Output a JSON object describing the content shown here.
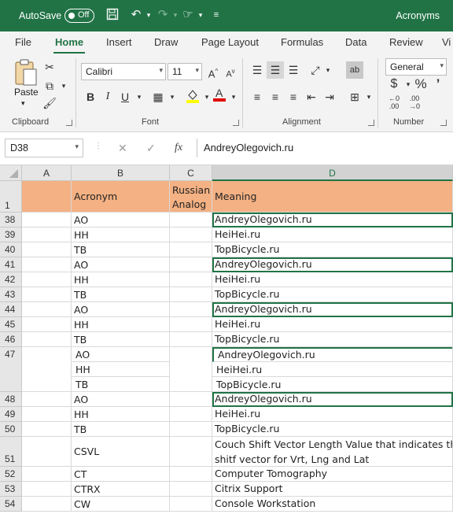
{
  "titlebar": {
    "autosave_label": "AutoSave",
    "autosave_state": "Off",
    "doc_title": "Acronyms"
  },
  "tabs": [
    "File",
    "Home",
    "Insert",
    "Draw",
    "Page Layout",
    "Formulas",
    "Data",
    "Review",
    "Vi"
  ],
  "ribbon": {
    "paste_label": "Paste",
    "font_name": "Calibri",
    "font_size": "11",
    "number_format": "General",
    "groups": {
      "clipboard": "Clipboard",
      "font": "Font",
      "alignment": "Alignment",
      "number": "Number"
    }
  },
  "formula_bar": {
    "name_box": "D38",
    "formula": "AndreyOlegovich.ru"
  },
  "grid": {
    "columns": [
      "A",
      "B",
      "C",
      "D"
    ],
    "header_row": {
      "row_num": "1",
      "b": "Acronym",
      "c_line1": "Russian",
      "c_line2": "Analog",
      "d": "Meaning"
    },
    "rows": [
      {
        "num": "38",
        "b": "AO",
        "d": "AndreyOlegovich.ru"
      },
      {
        "num": "39",
        "b": "HH",
        "d": "HeiHei.ru"
      },
      {
        "num": "40",
        "b": "TB",
        "d": "TopBicycle.ru"
      },
      {
        "num": "41",
        "b": "AO",
        "d": "AndreyOlegovich.ru"
      },
      {
        "num": "42",
        "b": "HH",
        "d": "HeiHei.ru"
      },
      {
        "num": "43",
        "b": "TB",
        "d": "TopBicycle.ru"
      },
      {
        "num": "44",
        "b": "AO",
        "d": "AndreyOlegovich.ru"
      },
      {
        "num": "45",
        "b": "HH",
        "d": "HeiHei.ru"
      },
      {
        "num": "46",
        "b": "TB",
        "d": "TopBicycle.ru"
      },
      {
        "num": "47",
        "b": "AO",
        "d": "AndreyOlegovich.ru",
        "b2": "HH",
        "d2": "HeiHei.ru",
        "b3": "TB",
        "d3": "TopBicycle.ru"
      },
      {
        "num": "48",
        "b": "AO",
        "d": "AndreyOlegovich.ru"
      },
      {
        "num": "49",
        "b": "HH",
        "d": "HeiHei.ru"
      },
      {
        "num": "50",
        "b": "TB",
        "d": "TopBicycle.ru"
      },
      {
        "num": "51",
        "b": "CSVL",
        "d": "Couch Shift Vector Length Value that indicates the",
        "d2": "shitf vector for Vrt, Lng and Lat"
      },
      {
        "num": "52",
        "b": "CT",
        "d": "Computer Tomography"
      },
      {
        "num": "53",
        "b": "CTRX",
        "d": "Citrix Support"
      },
      {
        "num": "54",
        "b": "CW",
        "d": "Console Workstation"
      }
    ]
  },
  "colors": {
    "brand_green": "#217346",
    "header_fill": "#f4b183"
  },
  "icons": [
    "save-icon",
    "undo-icon",
    "redo-icon",
    "touch-mode-icon",
    "customize-qat-icon",
    "paste-icon",
    "cut-icon",
    "copy-icon",
    "format-painter-icon",
    "bold-icon",
    "italic-icon",
    "underline-icon",
    "borders-icon",
    "fill-color-icon",
    "font-color-icon",
    "wrap-text-icon",
    "merge-center-icon",
    "currency-icon",
    "percent-icon",
    "comma-icon"
  ]
}
